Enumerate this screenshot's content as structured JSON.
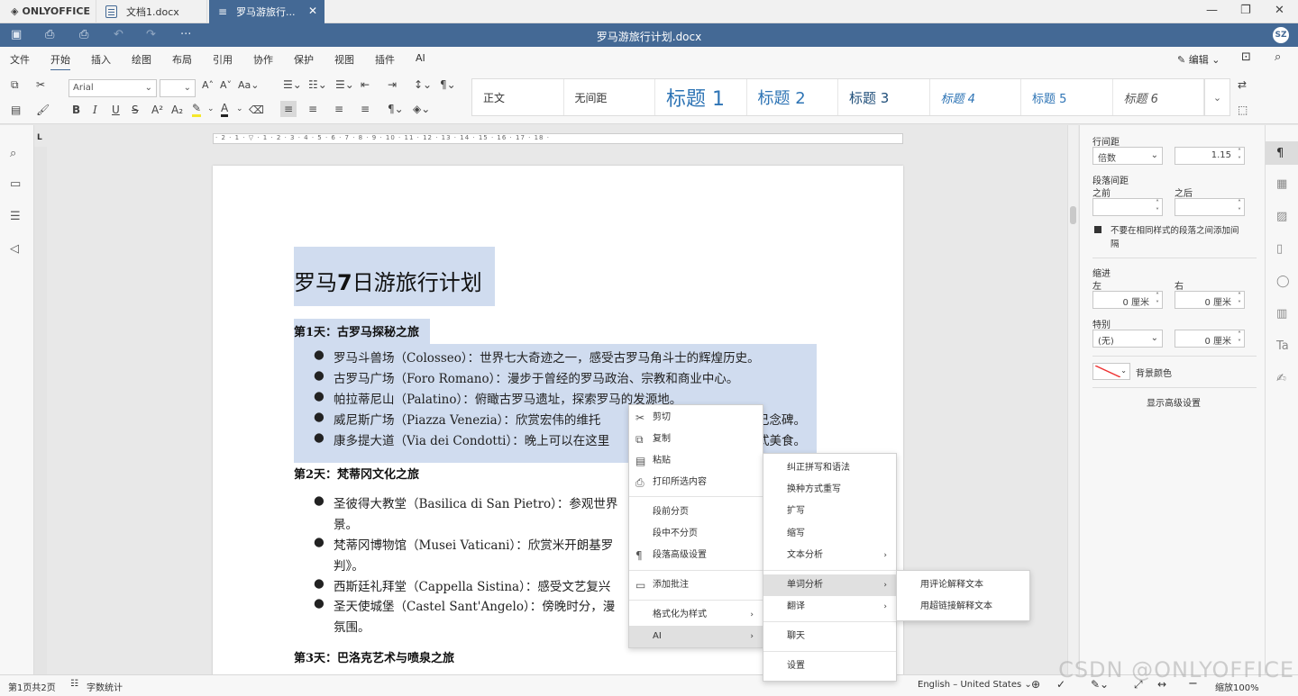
{
  "tabs": {
    "app_name": "ONLYOFFICE",
    "tab1_title": "文档1.docx",
    "tab2_title": "罗马游旅行...",
    "minimize": "—",
    "restore": "❐",
    "close": "✕"
  },
  "titlebar": {
    "doc_title": "罗马游旅行计划.docx",
    "avatar": "SZ"
  },
  "menu_tabs": [
    "文件",
    "开始",
    "插入",
    "绘图",
    "布局",
    "引用",
    "协作",
    "保护",
    "视图",
    "插件",
    "AI"
  ],
  "edit_mode": "编辑",
  "toolbar": {
    "font_name": "Arial",
    "font_size": "",
    "styles": [
      "正文",
      "无间距",
      "标题 1",
      "标题 2",
      "标题 3",
      "标题 4",
      "标题 5",
      "标题 6"
    ]
  },
  "ruler_text": "· 2 · 1 · ▽ · 1 · 2 · 3 · 4 · 5 · 6 · 7 · 8 · 9 · 10 · 11 · 12 · 13 · 14 · 15 · 16 · 17 · 18 ·",
  "document": {
    "title_pre": "罗马",
    "title_bold": "7",
    "title_post": "日游旅行计划",
    "day1": "第1天：古罗马探秘之旅",
    "day1_items": [
      "罗马斗兽场（Colosseo）：世界七大奇迹之一，感受古罗马角斗士的辉煌历史。",
      "古罗马广场（Foro Romano）：漫步于曾经的罗马政治、宗教和商业中心。",
      "帕拉蒂尼山（Palatino）：俯瞰古罗马遗址，探索罗马的发源地。",
      "威尼斯广场（Piazza Venezia）：欣赏宏伟的维托",
      "康多提大道（Via dei Condotti）：晚上可以在这里"
    ],
    "day1_tail": [
      "己念碑。",
      "式美食。"
    ],
    "day2": "第2天：梵蒂冈文化之旅",
    "day2_items": [
      "圣彼得大教堂（Basilica di San Pietro）：参观世界",
      "景。",
      "梵蒂冈博物馆（Musei Vaticani）：欣赏米开朗基罗",
      "判》。",
      "西斯廷礼拜堂（Cappella Sistina）：感受文艺复兴",
      "圣天使城堡（Castel Sant'Angelo）：傍晚时分，漫",
      "氛围。"
    ],
    "day3": "第3天：巴洛克艺术与喷泉之旅"
  },
  "right_panel": {
    "line_spacing": "行间距",
    "line_mode": "倍数",
    "line_value": "1.15",
    "para_spacing": "段落间距",
    "before": "之前",
    "after": "之后",
    "no_space_label": "不要在相同样式的段落之间添加间",
    "no_space_label2": "隔",
    "indent": "缩进",
    "left": "左",
    "right": "右",
    "left_val": "0 厘米",
    "right_val": "0 厘米",
    "special": "特别",
    "special_val": "(无)",
    "special_amount": "0 厘米",
    "bg_color": "背景颜色",
    "advanced": "显示高级设置"
  },
  "context_menu": {
    "cut": "剪切",
    "copy": "复制",
    "paste": "粘贴",
    "print_sel": "打印所选内容",
    "page_break_before": "段前分页",
    "keep_lines": "段中不分页",
    "para_adv": "段落高级设置",
    "add_comment": "添加批注",
    "format_style": "格式化为样式",
    "ai": "AI"
  },
  "ai_menu": {
    "fix": "纠正拼写和语法",
    "rewrite": "换种方式重写",
    "expand": "扩写",
    "shorten": "缩写",
    "text_analysis": "文本分析",
    "word_analysis": "单词分析",
    "translate": "翻译",
    "chat": "聊天",
    "settings": "设置"
  },
  "word_menu": {
    "explain_comment": "用评论解释文本",
    "explain_link": "用超链接解释文本"
  },
  "status": {
    "pages": "第1页共2页",
    "word_count": "字数统计",
    "language": "English – United States",
    "zoom": "缩放100%"
  },
  "watermark": "CSDN @ONLYOFFICE"
}
